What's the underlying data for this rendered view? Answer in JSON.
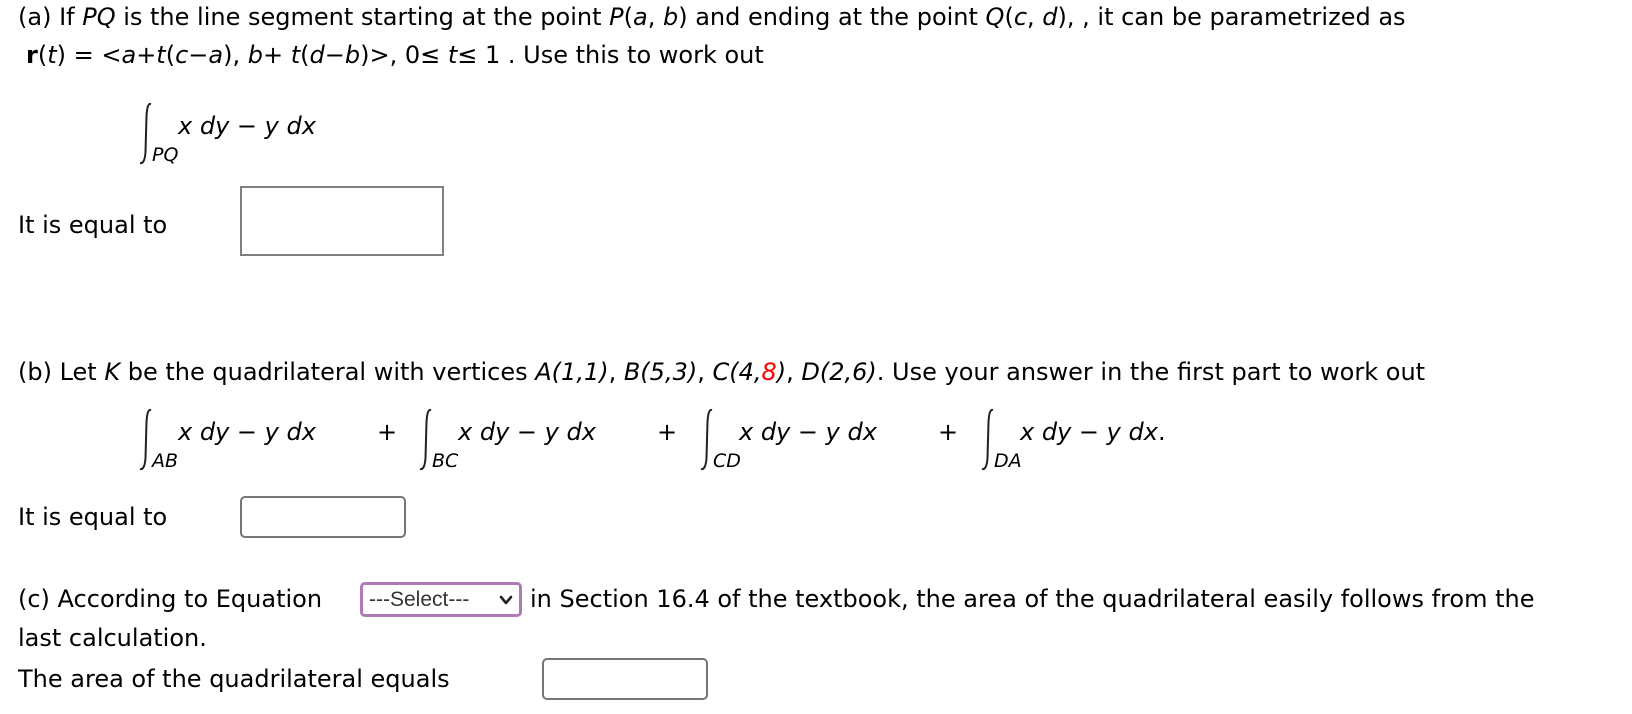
{
  "part_a": {
    "line1": {
      "prefix": "(a) If ",
      "pq": "PQ",
      "mid1": " is the line segment starting at the point  ",
      "P": "P",
      "p_args_open": "(",
      "a": "a",
      "comma1": ", ",
      "b": "b",
      "p_args_close": ")",
      "mid2": "  and ending at the point  ",
      "Q": "Q",
      "q_args_open": "(",
      "c": "c",
      "comma2": ", ",
      "d": "d",
      "q_args_close": ")",
      "suffix": ", , it can be parametrized as"
    },
    "line2": {
      "r": "r",
      "t_open": "(",
      "t": "t",
      "t_close": ") = <",
      "expr1": "a+t",
      "paren1": "(",
      "expr2": "c−a",
      "paren2": "), ",
      "expr3": "b",
      "plus": "+ ",
      "expr4": "t",
      "paren3": "(",
      "expr5": "d−b",
      "paren4": ")>, 0≤ ",
      "expr6": "t",
      "tail": "≤ 1 . Use this to work out"
    },
    "integral": {
      "subscript": "PQ",
      "x": "x dy",
      "minus": " − ",
      "y": "y dx"
    },
    "answer_label": "It is equal to",
    "answer_value": ""
  },
  "part_b": {
    "line": {
      "prefix": "(b) Let ",
      "K": "K",
      "mid": " be the quadrilateral with vertices ",
      "A": "A(1,1)",
      "sep1": ", ",
      "B": "B(5,3)",
      "sep2": ", ",
      "C_open": "C(4,",
      "C_red": "8",
      "C_close": ")",
      "sep3": ", ",
      "D": "D(2,6)",
      "suffix": ". Use your answer in the first part to work out"
    },
    "integrals": [
      {
        "subscript": "AB",
        "x": "x dy",
        "minus": " − ",
        "y": "y dx",
        "end": ""
      },
      {
        "subscript": "BC",
        "x": "x dy",
        "minus": " − ",
        "y": "y dx",
        "end": ""
      },
      {
        "subscript": "CD",
        "x": "x dy",
        "minus": " − ",
        "y": "y dx",
        "end": ""
      },
      {
        "subscript": "DA",
        "x": "x dy",
        "minus": " − ",
        "y": "y dx",
        "end": "."
      }
    ],
    "plus_sign": "+",
    "highlight_color": "#ff0000",
    "answer_label": "It is equal to",
    "answer_value": ""
  },
  "part_c": {
    "prefix": "(c) According to Equation ",
    "select_value": "---Select---",
    "suffix": " in Section 16.4 of the textbook, the area of the quadrilateral easily follows from the",
    "line2": "last calculation.",
    "answer_label": "The area of the quadrilateral equals",
    "answer_value": "",
    "select_border_color": "#b07ab5"
  }
}
